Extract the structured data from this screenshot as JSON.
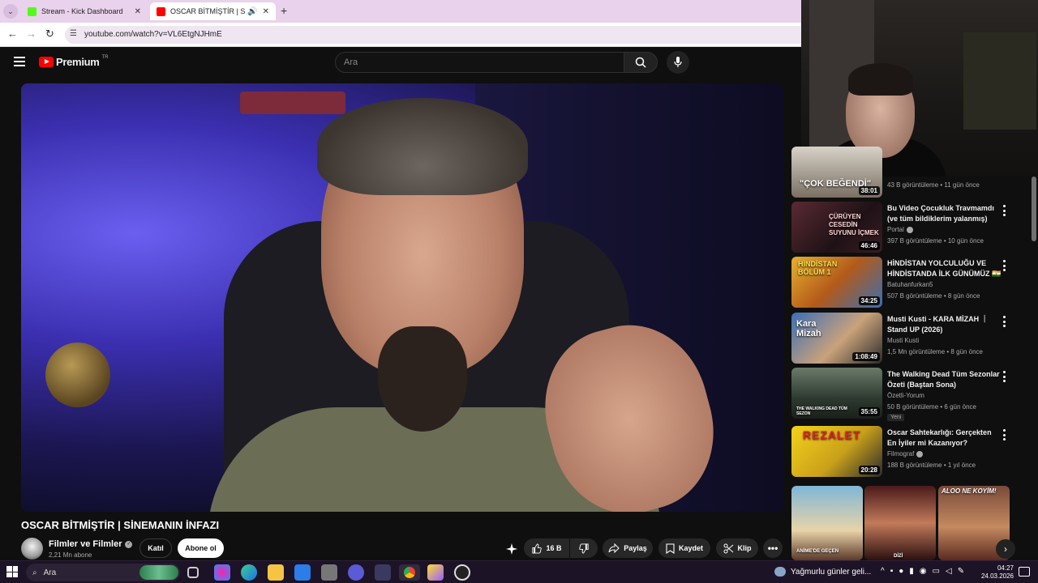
{
  "browser": {
    "tabs": [
      {
        "label": "Stream - Kick Dashboard",
        "favicon_color": "#53fc18"
      },
      {
        "label": "OSCAR BİTMİŞTİR | SİNEMANIN İNFAZI - YouTube",
        "favicon_color": "#ff0000"
      }
    ],
    "url": "youtube.com/watch?v=VL6EtgNJHmE"
  },
  "youtube": {
    "logo_text": "Premium",
    "country_code": "TR",
    "search_placeholder": "Ara",
    "video": {
      "title": "OSCAR BİTMİŞTİR | SİNEMANIN İNFAZI",
      "channel_name": "Filmler ve Filmler",
      "subscribers": "2,21 Mn abone",
      "join_label": "Katıl",
      "subscribe_label": "Abone ol",
      "like_count": "16 B",
      "share_label": "Paylaş",
      "save_label": "Kaydet",
      "clip_label": "Klip"
    },
    "sidebar": {
      "partial": {
        "thumb_caption": "\"ÇOK BEĞENDİ\"",
        "duration": "38:01",
        "meta": "43 B görüntüleme • 11 gün önce"
      },
      "videos": [
        {
          "title": "Bu Video Çocukluk Travmamdı (ve tüm bildiklerim yalanmış)",
          "channel": "Portal",
          "verified": true,
          "meta": "397 B görüntüleme • 10 gün önce",
          "duration": "46:46",
          "thumb_caption": "ÇÜRÜYEN CESEDİN SUYUNU İÇMEK",
          "new": false
        },
        {
          "title": "HİNDİSTAN YOLCULUĞU VE HİNDİSTANDA İLK GÜNÜMÜZ 🇮🇳",
          "channel": "Batuhanfurkan5",
          "verified": false,
          "meta": "507 B görüntüleme • 8 gün önce",
          "duration": "34:25",
          "thumb_caption": "HİNDİSTAN BÖLÜM 1",
          "new": false
        },
        {
          "title": "Musti Kusti - KARA MİZAH ｜ Stand UP (2026)",
          "channel": "Musti Kusti",
          "verified": false,
          "meta": "1,5 Mn görüntüleme • 8 gün önce",
          "duration": "1:08:49",
          "thumb_caption": "Kara Mizah",
          "new": false
        },
        {
          "title": "The Walking Dead Tüm Sezonlar Özeti (Baştan Sona)",
          "channel": "Özetli-Yorum",
          "verified": false,
          "meta": "50 B görüntüleme • 6 gün önce",
          "duration": "35:55",
          "thumb_caption": "THE WALKING DEAD TÜM SEZON",
          "new": true,
          "new_label": "Yeni"
        },
        {
          "title": "Oscar Sahtekarlığı: Gerçekten En İyiler mi Kazanıyor?",
          "channel": "Filmograf",
          "verified": true,
          "meta": "188 B görüntüleme • 1 yıl önce",
          "duration": "20:28",
          "thumb_caption": "REZALET",
          "new": false
        }
      ],
      "shorts": [
        {
          "caption": "ANİME'DE GEÇEN"
        },
        {
          "caption": "DİZİ"
        },
        {
          "caption": "ALOO NE KOYİM!"
        }
      ]
    }
  },
  "taskbar": {
    "search_label": "Ara",
    "weather_text": "Yağmurlu günler geli...",
    "time": "04:27",
    "date": "24.03.2026"
  }
}
